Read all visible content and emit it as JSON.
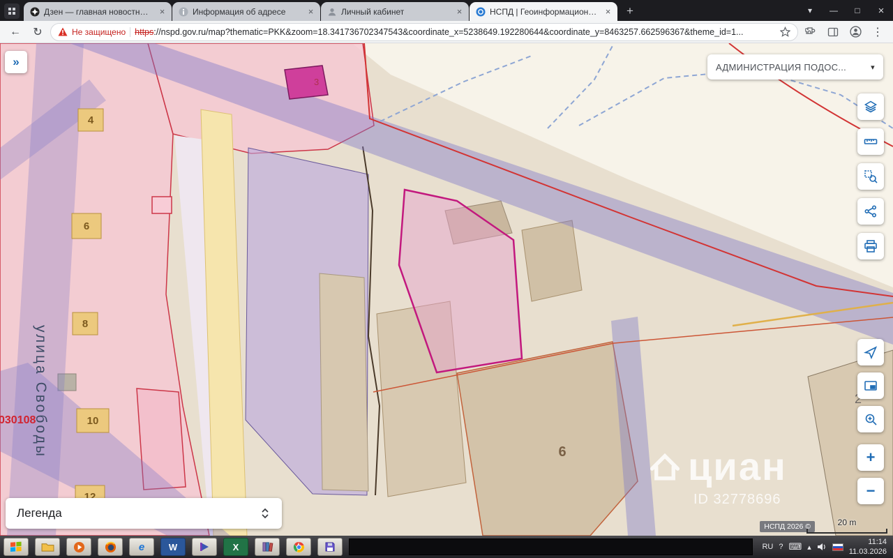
{
  "browser": {
    "tabs": [
      {
        "title": "Дзен — главная новостная инф"
      },
      {
        "title": "Информация об адресе"
      },
      {
        "title": "Личный кабинет"
      },
      {
        "title": "НСПД | Геоинформационный п"
      }
    ],
    "nav": {
      "warning": "Не защищено",
      "url_scheme": "https",
      "url_rest": "://nspd.gov.ru/map?thematic=PKK&zoom=18.341736702347543&coordinate_x=5238649.192280644&coordinate_y=8463257.662596367&theme_id=1..."
    }
  },
  "map": {
    "org_dropdown": "АДМИНИСТРАЦИЯ ПОДОС...",
    "legend_title": "Легенда",
    "street_name": "улица Свободы",
    "quarter_number": "030108",
    "labels": {
      "p3": "3",
      "p4": "4",
      "p6": "6",
      "p8": "8",
      "p10": "10",
      "p12": "12",
      "b6": "6",
      "b2": "2"
    },
    "watermark": {
      "brand": "циан",
      "id": "ID 32778696"
    },
    "copyright": "НСПД 2026 ©",
    "scale_label": "20 m"
  },
  "icons": {
    "expand": "»",
    "close": "×",
    "new_tab": "+",
    "menu": "⋮",
    "back": "←",
    "reload": "↻",
    "caret": "▾",
    "tab_search": "▾",
    "win_min": "—",
    "win_max": "□",
    "win_close": "×",
    "zoom_in": "+",
    "zoom_out": "−",
    "tray_hidden": "▴",
    "tray_keyboard": "⌨",
    "tray_help": "?"
  },
  "taskbar": {
    "language": "RU",
    "time": "11:14",
    "date": "11.03.2026",
    "letters": {
      "ie": "e",
      "word": "W",
      "excel": "X"
    }
  },
  "accent": {
    "nspd_blue": "#1f6cb5",
    "warning_red": "#c5221f",
    "selected_parcel": "#c2187e"
  }
}
